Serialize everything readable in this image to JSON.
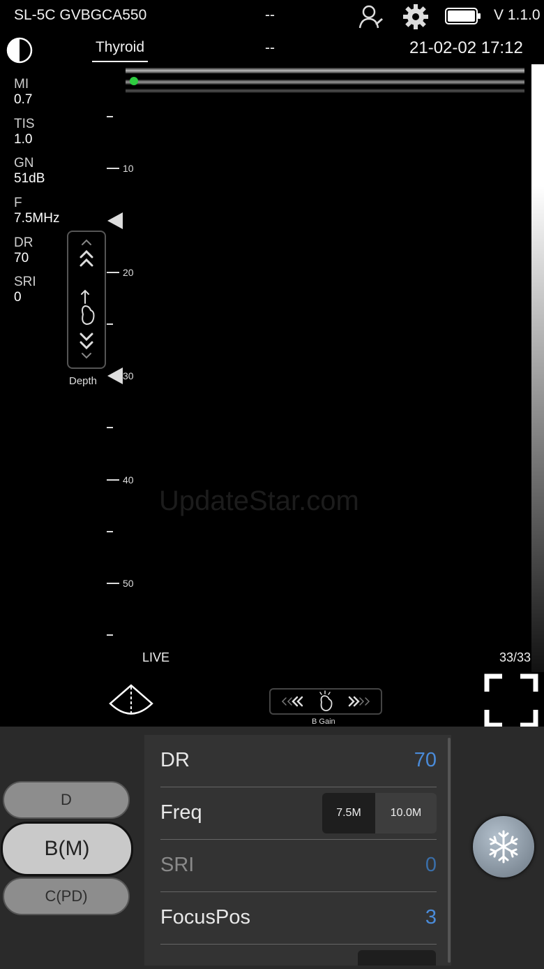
{
  "status_bar": {
    "device": "SL-5C GVBGCA550",
    "center_top": "--",
    "version": "V 1.1.0"
  },
  "header": {
    "preset": "Thyroid",
    "center": "--",
    "datetime": "21-02-02 17:12"
  },
  "params": [
    {
      "label": "MI",
      "value": "0.7"
    },
    {
      "label": "TIS",
      "value": "1.0"
    },
    {
      "label": "GN",
      "value": "51dB"
    },
    {
      "label": "F",
      "value": "7.5MHz"
    },
    {
      "label": "DR",
      "value": "70"
    },
    {
      "label": "SRI",
      "value": "0"
    }
  ],
  "depth_scale": {
    "labels": [
      "10",
      "20",
      "30",
      "40",
      "50"
    ]
  },
  "depth_control": {
    "label": "Depth"
  },
  "watermark": "UpdateStar.com",
  "image_status": {
    "mode": "LIVE",
    "frames": "33/33"
  },
  "gain_control": {
    "label": "B Gain"
  },
  "modes": [
    {
      "label": "D"
    },
    {
      "label": "B(M)"
    },
    {
      "label": "C(PD)"
    }
  ],
  "settings": {
    "dr": {
      "label": "DR",
      "value": "70"
    },
    "freq": {
      "label": "Freq",
      "options": [
        "7.5M",
        "10.0M"
      ],
      "selected": "7.5M"
    },
    "sri": {
      "label": "SRI",
      "value": "0"
    },
    "focus": {
      "label": "FocusPos",
      "value": "3"
    }
  },
  "colors": {
    "accent": "#4a8bd9",
    "focus_dot": "#2ecc40"
  }
}
